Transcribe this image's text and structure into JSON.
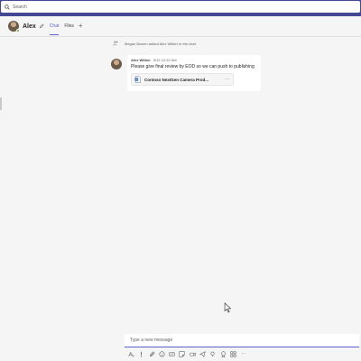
{
  "search": {
    "placeholder": "Search"
  },
  "header": {
    "name": "Alex",
    "tabs": [
      {
        "label": "Chat",
        "active": true
      },
      {
        "label": "Files",
        "active": false
      }
    ],
    "add_tab_glyph": "+"
  },
  "system_message": {
    "text": "Megan Bowen added Alex Wilber to the chat."
  },
  "message": {
    "author": "Alex Wilber",
    "time": "9/12 12:22 AM",
    "text": "Please give final review by EOD so we can push to publishing",
    "attachment": {
      "name": "Contoso NextGen Camera Prod...",
      "more_glyph": "···"
    }
  },
  "compose": {
    "placeholder": "Type a new message"
  },
  "toolbar": {
    "icons": [
      "format-icon",
      "priority-icon",
      "attach-icon",
      "emoji-icon",
      "gif-icon",
      "sticker-icon",
      "meet-icon",
      "schedule-icon",
      "loop-icon",
      "praise-icon",
      "apps-icon",
      "more-options-icon"
    ],
    "more_glyph": "···"
  },
  "colors": {
    "brand": "#444791",
    "accent": "#5b5fc7",
    "background": "#f5f5f5",
    "status_available": "#6bb700"
  }
}
